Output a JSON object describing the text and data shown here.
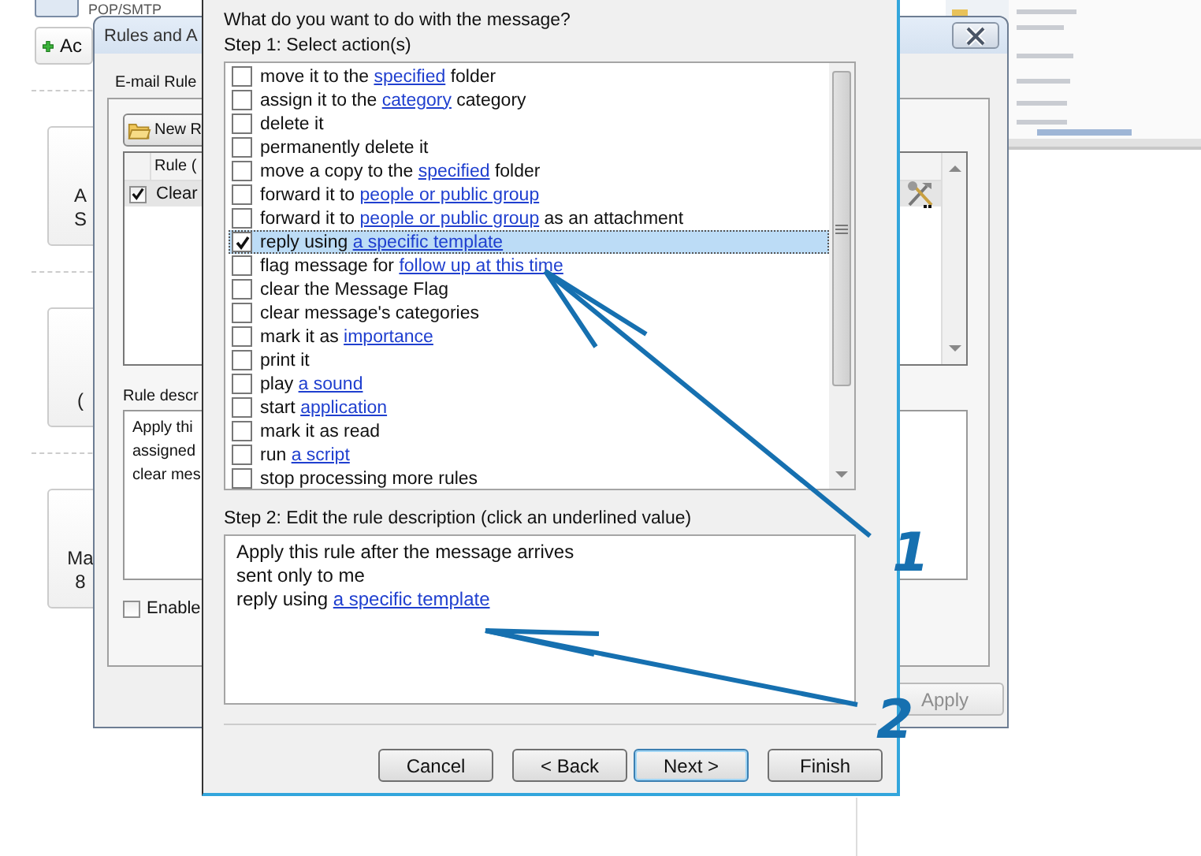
{
  "backstage": {
    "top_item": "POP/SMTP",
    "add_button": "Ac",
    "tiles": [
      {
        "lines": [
          "A",
          "S"
        ]
      },
      {
        "lines": [
          "("
        ]
      },
      {
        "lines": [
          "Ma",
          "8"
        ]
      }
    ]
  },
  "rules_window": {
    "title": "Rules and A",
    "tab": "E-mail Rule",
    "new_rule_button": "New R",
    "table": {
      "header": "Rule (",
      "rows": [
        {
          "name": "Clear",
          "checked": true
        }
      ]
    },
    "description_label": "Rule descr",
    "description": [
      "Apply thi",
      "assigned",
      "clear mes"
    ],
    "enable": {
      "label": "Enable",
      "checked": false
    },
    "apply_button": {
      "label": "Apply",
      "disabled": true
    }
  },
  "dialog": {
    "question": "What do you want to do with the message?",
    "step1_label": "Step 1: Select action(s)",
    "actions": [
      {
        "checked": false,
        "selected": false,
        "parts": [
          {
            "text": "move it to the "
          },
          {
            "text": "specified",
            "link": true
          },
          {
            "text": " folder"
          }
        ]
      },
      {
        "checked": false,
        "selected": false,
        "parts": [
          {
            "text": "assign it to the "
          },
          {
            "text": "category",
            "link": true
          },
          {
            "text": " category"
          }
        ]
      },
      {
        "checked": false,
        "selected": false,
        "parts": [
          {
            "text": "delete it"
          }
        ]
      },
      {
        "checked": false,
        "selected": false,
        "parts": [
          {
            "text": "permanently delete it"
          }
        ]
      },
      {
        "checked": false,
        "selected": false,
        "parts": [
          {
            "text": "move a copy to the "
          },
          {
            "text": "specified",
            "link": true
          },
          {
            "text": " folder"
          }
        ]
      },
      {
        "checked": false,
        "selected": false,
        "parts": [
          {
            "text": "forward it to "
          },
          {
            "text": "people or public group",
            "link": true
          }
        ]
      },
      {
        "checked": false,
        "selected": false,
        "parts": [
          {
            "text": "forward it to "
          },
          {
            "text": "people or public group",
            "link": true
          },
          {
            "text": " as an attachment"
          }
        ]
      },
      {
        "checked": true,
        "selected": true,
        "parts": [
          {
            "text": "reply using "
          },
          {
            "text": "a specific template",
            "link": true
          }
        ]
      },
      {
        "checked": false,
        "selected": false,
        "parts": [
          {
            "text": "flag message for "
          },
          {
            "text": "follow up at this time",
            "link": true
          }
        ]
      },
      {
        "checked": false,
        "selected": false,
        "parts": [
          {
            "text": "clear the Message Flag"
          }
        ]
      },
      {
        "checked": false,
        "selected": false,
        "parts": [
          {
            "text": "clear message's categories"
          }
        ]
      },
      {
        "checked": false,
        "selected": false,
        "parts": [
          {
            "text": "mark it as "
          },
          {
            "text": "importance",
            "link": true
          }
        ]
      },
      {
        "checked": false,
        "selected": false,
        "parts": [
          {
            "text": "print it"
          }
        ]
      },
      {
        "checked": false,
        "selected": false,
        "parts": [
          {
            "text": "play "
          },
          {
            "text": "a sound",
            "link": true
          }
        ]
      },
      {
        "checked": false,
        "selected": false,
        "parts": [
          {
            "text": "start "
          },
          {
            "text": "application",
            "link": true
          }
        ]
      },
      {
        "checked": false,
        "selected": false,
        "parts": [
          {
            "text": "mark it as read"
          }
        ]
      },
      {
        "checked": false,
        "selected": false,
        "parts": [
          {
            "text": "run "
          },
          {
            "text": "a script",
            "link": true
          }
        ]
      },
      {
        "checked": false,
        "selected": false,
        "parts": [
          {
            "text": "stop processing more rules"
          }
        ]
      }
    ],
    "step2_label": "Step 2: Edit the rule description (click an underlined value)",
    "description": [
      {
        "parts": [
          {
            "text": "Apply this rule after the message arrives"
          }
        ]
      },
      {
        "parts": [
          {
            "text": "sent only to me"
          }
        ]
      },
      {
        "parts": [
          {
            "text": "reply using "
          },
          {
            "text": "a specific template",
            "link": true
          }
        ]
      }
    ],
    "buttons": [
      {
        "label": "Cancel",
        "default": false
      },
      {
        "label": "< Back",
        "default": false
      },
      {
        "label": "Next >",
        "default": true
      },
      {
        "label": "Finish",
        "default": false
      }
    ]
  },
  "annotations": [
    {
      "label": "1"
    },
    {
      "label": "2"
    }
  ]
}
